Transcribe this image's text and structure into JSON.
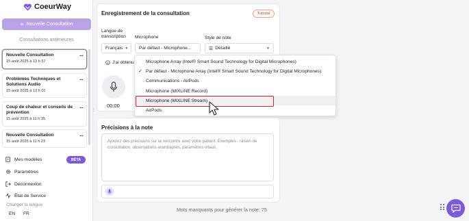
{
  "app": {
    "logo_text": "CoeurWay",
    "brand_color": "#7b5bd6"
  },
  "sidebar": {
    "new_button": "Nouvelle Consultation",
    "previous_label": "Consultations antérieures",
    "consultations": [
      {
        "title": "Nouvelle Consultation",
        "date": "15 août 2025 à 13 h 57"
      },
      {
        "title": "Problèmes Techniques et Solutions Audio",
        "date": "15 août 2025 à 13 h 01"
      },
      {
        "title": "Coup de chaleur et conseils de prévention",
        "date": "15 août 2025 à 11 h 35"
      },
      {
        "title": "Nouvelle Consultation",
        "date": "15 août 2025 à 11 h 23"
      }
    ],
    "menu": {
      "models": "Mes modèles",
      "beta": "BÊTA",
      "settings": "Paramètres",
      "logout": "Déconnexion",
      "service_status": "État de Service"
    },
    "language_label": "Changer la langue",
    "languages": [
      "EN",
      "FR"
    ]
  },
  "consultation": {
    "title": "Enregistrement de la consultation",
    "tutorial": "Tutorial",
    "transcription_label": "Langue de transcription",
    "transcription_value": "Français",
    "microphone_label": "Microphone",
    "microphone_value": "Par défaut - Microphone...",
    "note_style_label": "Style de note",
    "note_style_value": "Détaillé",
    "info_text": "J'ai obtenu",
    "timer": "00:00"
  },
  "microphone_dropdown": {
    "options": [
      "Microphone Array (Intel® Smart Sound Technology for Digital Microphones)",
      "Par défaut - Microphone Array (Intel® Smart Sound Technology for Digital Microphones)",
      "Communications - AirPods",
      "Microphone (MIXLINE Record)",
      "Microphone (MIXLINE Stream)",
      "AirPods"
    ],
    "selected_index": 1,
    "hovered_index": 4
  },
  "notes": {
    "title": "Précisions à la note",
    "placeholder": "Ajoutez des précisions sur la rencontre avec votre patient. Exemples : raison de consultation, observations avant/après, paramètres vitaux."
  },
  "footer": {
    "missing_words": "Mots manquants pour générer la note: 75"
  }
}
